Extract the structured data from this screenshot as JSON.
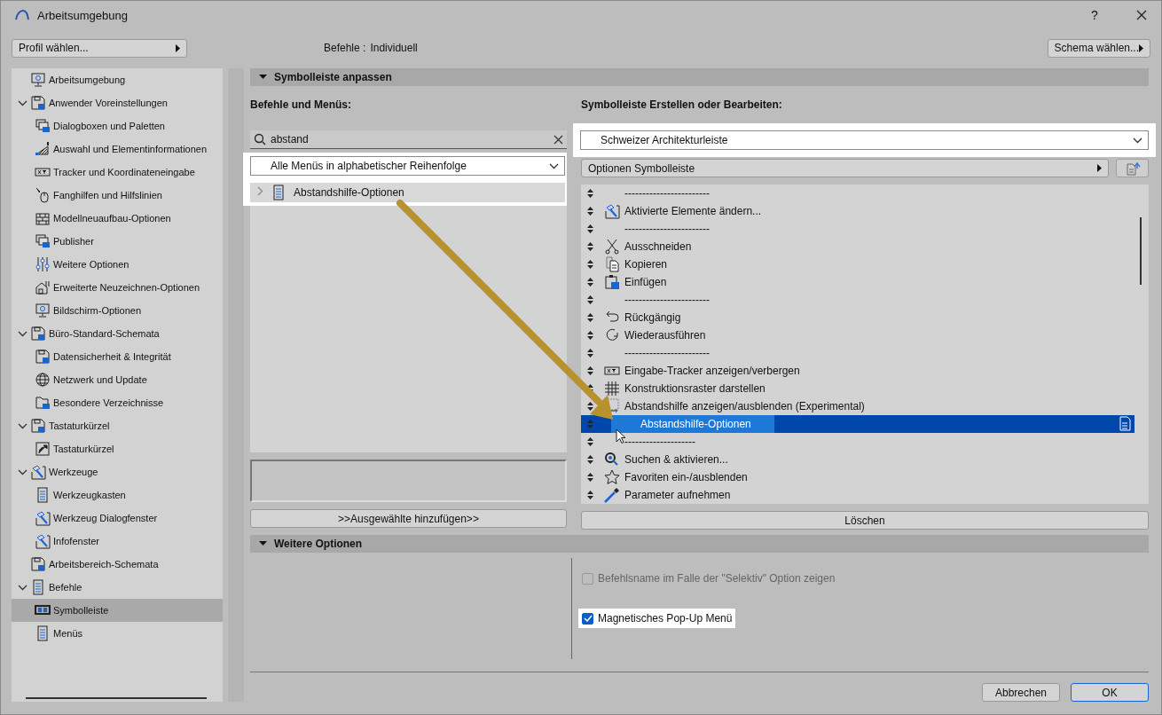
{
  "window": {
    "title": "Arbeitsumgebung",
    "help_button": "?"
  },
  "top_bar": {
    "profile_button": "Profil wählen...",
    "commands_label": "Befehle :",
    "commands_value": "Individuell",
    "schema_button": "Schema wählen..."
  },
  "sidebar": {
    "items": [
      {
        "label": "Arbeitsumgebung",
        "selected": false
      },
      {
        "label": "Anwender Voreinstellungen",
        "selected": false,
        "expanded": true,
        "children": [
          {
            "label": "Dialogboxen und Paletten",
            "selected": false
          },
          {
            "label": "Auswahl und Elementinformationen",
            "selected": false
          },
          {
            "label": "Tracker und Koordinateneingabe",
            "selected": false
          },
          {
            "label": "Fanghilfen und Hilfslinien",
            "selected": false
          },
          {
            "label": "Modellneuaufbau-Optionen",
            "selected": false
          },
          {
            "label": "Publisher",
            "selected": false
          },
          {
            "label": "Weitere Optionen",
            "selected": false
          },
          {
            "label": "Erweiterte Neuzeichnen-Optionen",
            "selected": false
          },
          {
            "label": "Bildschirm-Optionen",
            "selected": false
          }
        ]
      },
      {
        "label": "Büro-Standard-Schemata",
        "selected": false,
        "expanded": true,
        "children": [
          {
            "label": "Datensicherheit & Integrität",
            "selected": false
          },
          {
            "label": "Netzwerk und Update",
            "selected": false
          },
          {
            "label": "Besondere Verzeichnisse",
            "selected": false
          }
        ]
      },
      {
        "label": "Tastaturkürzel",
        "selected": false,
        "expanded": true,
        "children": [
          {
            "label": "Tastaturkürzel",
            "selected": false
          }
        ]
      },
      {
        "label": "Werkzeuge",
        "selected": false,
        "expanded": true,
        "children": [
          {
            "label": "Werkzeugkasten",
            "selected": false
          },
          {
            "label": "Werkzeug Dialogfenster",
            "selected": false
          },
          {
            "label": "Infofenster",
            "selected": false
          }
        ]
      },
      {
        "label": "Arbeitsbereich-Schemata",
        "selected": false
      },
      {
        "label": "Befehle",
        "selected": false,
        "expanded": true,
        "children": [
          {
            "label": "Symbolleiste",
            "selected": true
          },
          {
            "label": "Menüs",
            "selected": false
          }
        ]
      }
    ]
  },
  "toolbar_section": {
    "title": "Symbolleiste anpassen",
    "expanded": true,
    "commands_panel": {
      "heading": "Befehle und Menüs:",
      "search": {
        "value": "abstand"
      },
      "menu_dropdown": "Alle Menüs in alphabetischer Reihenfolge",
      "results": [
        {
          "label": "Abstandshilfe-Optionen",
          "expanded": false
        }
      ],
      "add_button": ">>Ausgewählte hinzufügen>>"
    },
    "toolbar_panel": {
      "heading": "Symbolleiste Erstellen oder Bearbeiten:",
      "toolbar_dropdown": "Schweizer Architekturleiste",
      "options_button": "Optionen Symbolleiste",
      "items": [
        {
          "kind": "separator",
          "label": "------------------------",
          "selected": false
        },
        {
          "kind": "command",
          "label": "Aktivierte Elemente ändern...",
          "selected": false
        },
        {
          "kind": "separator",
          "label": "------------------------",
          "selected": false
        },
        {
          "kind": "command",
          "label": "Ausschneiden",
          "selected": false
        },
        {
          "kind": "command",
          "label": "Kopieren",
          "selected": false
        },
        {
          "kind": "command",
          "label": "Einfügen",
          "selected": false
        },
        {
          "kind": "separator",
          "label": "------------------------",
          "selected": false
        },
        {
          "kind": "command",
          "label": "Rückgängig",
          "selected": false
        },
        {
          "kind": "command",
          "label": "Wiederausführen",
          "selected": false
        },
        {
          "kind": "separator",
          "label": "------------------------",
          "selected": false
        },
        {
          "kind": "command",
          "label": "Eingabe-Tracker anzeigen/verbergen",
          "selected": false
        },
        {
          "kind": "command",
          "label": "Konstruktionsraster darstellen",
          "selected": false
        },
        {
          "kind": "command",
          "label": "Abstandshilfe anzeigen/ausblenden (Experimental)",
          "selected": false
        },
        {
          "kind": "command",
          "label": "Abstandshilfe-Optionen",
          "selected": true
        },
        {
          "kind": "separator",
          "label": "--------------------",
          "selected": false
        },
        {
          "kind": "command",
          "label": "Suchen & aktivieren...",
          "selected": false
        },
        {
          "kind": "command",
          "label": "Favoriten ein-/ausblenden",
          "selected": false
        },
        {
          "kind": "command",
          "label": "Parameter aufnehmen",
          "selected": false
        }
      ],
      "delete_button": "Löschen"
    }
  },
  "more_options_section": {
    "title": "Weitere Optionen",
    "expanded": true,
    "options": [
      {
        "label": "Befehlsname im Falle der \"Selektiv\" Option zeigen",
        "checked": false,
        "disabled": true,
        "highlighted": false
      },
      {
        "label": "Magnetisches Pop-Up Menü",
        "checked": true,
        "disabled": false,
        "highlighted": true
      }
    ]
  },
  "buttons": [
    {
      "label": "Abbrechen",
      "default": false
    },
    {
      "label": "OK",
      "default": true
    }
  ]
}
